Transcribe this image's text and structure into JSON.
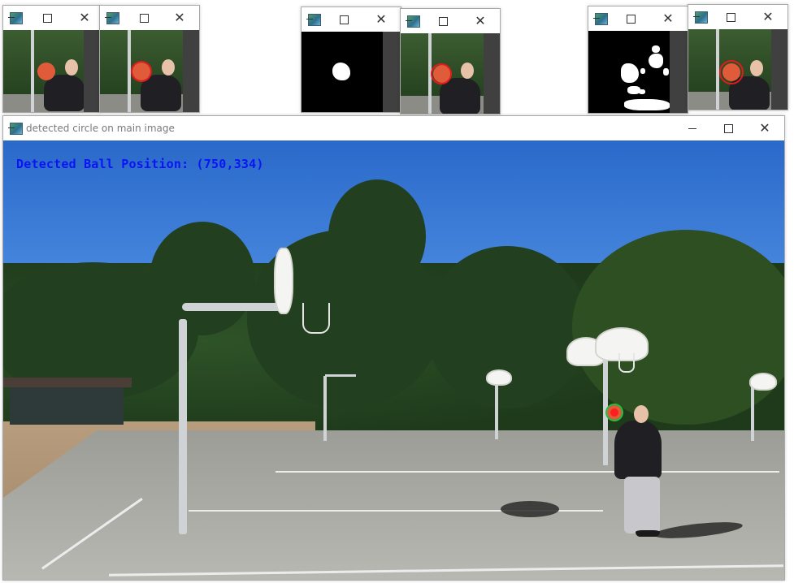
{
  "colors": {
    "detection_text": "#0a14f5",
    "detected_circle": "#20c040",
    "candidate_circle": "#e11b1b",
    "mask_background": "#000000",
    "mask_foreground": "#ffffff"
  },
  "window_icons": {
    "app": "opencv-window-icon",
    "minimize": "minimize-icon",
    "maximize": "maximize-icon",
    "close": "close-icon"
  },
  "controls": {
    "close_glyph": "✕"
  },
  "main_window": {
    "title": "detected circle on main image",
    "overlay_text": "Detected Ball Position: (750,334)"
  }
}
